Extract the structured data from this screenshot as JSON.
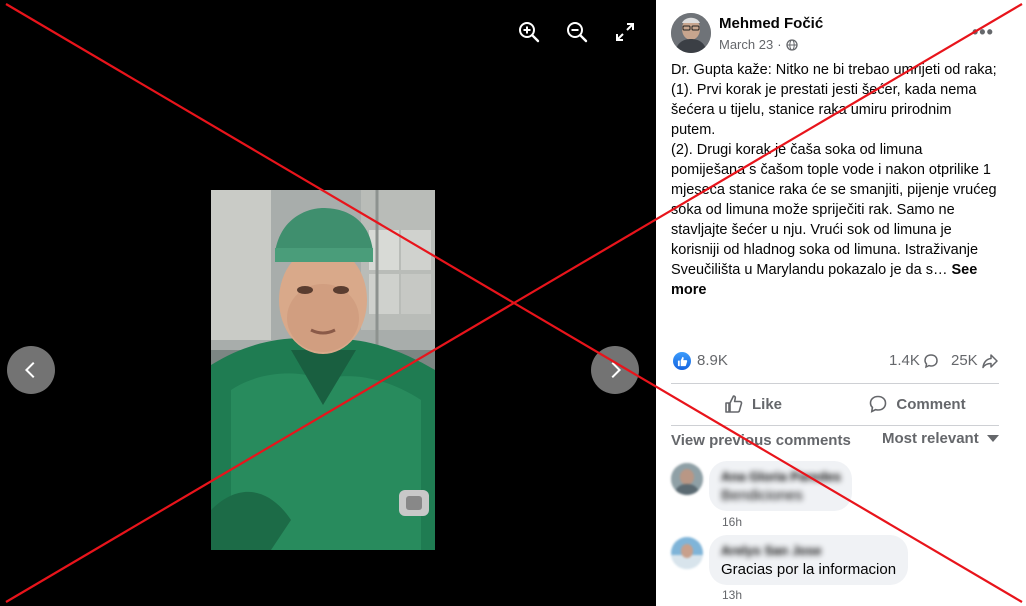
{
  "viewer": {
    "zoom_in_icon": "zoom-in-icon",
    "zoom_out_icon": "zoom-out-icon",
    "fullscreen_icon": "expand-icon",
    "prev_icon": "chevron-left-icon",
    "next_icon": "chevron-right-icon"
  },
  "post": {
    "author": "Mehmed Fočić",
    "date": "March 23",
    "date_separator": "·",
    "audience_icon": "globe-icon",
    "more_icon": "•••",
    "paragraphs": [
      "Dr. Gupta kaže: Nitko ne bi trebao umrijeti od raka;",
      "(1). Prvi korak je prestati jesti šećer, kada nema šećera u tijelu, stanice raka umiru prirodnim putem.",
      "(2). Drugi korak je čaša soka od limuna pomiješana s čašom tople vode i nakon otprilike 1 mjeseca stanice raka će se smanjiti, pijenje vrućeg soka od limuna može spriječiti rak. Samo ne stavljajte šećer u nju. Vrući sok od limuna je korisniji od hladnog soka od limuna. Istraživanje Sveučilišta u Marylandu pokazalo je da s…"
    ],
    "see_more": "See more",
    "reactions": "8.9K",
    "comments_count": "1.4K",
    "shares_count": "25K"
  },
  "actions": {
    "like": "Like",
    "comment": "Comment"
  },
  "comments_section": {
    "view_previous": "View previous comments",
    "sort_label": "Most relevant",
    "items": [
      {
        "name": "Ana Gloria Paredes",
        "text": "Bendiciones",
        "text_blurred": true,
        "time": "16h"
      },
      {
        "name": "Arelys San Jose",
        "text": "Gracias por la informacion",
        "text_blurred": false,
        "time": "13h"
      }
    ]
  },
  "colors": {
    "viewer_bg": "#000000",
    "cross": "#e8141b",
    "secondary_text": "#65676b",
    "bubble_bg": "#f0f2f5",
    "like_blue": "#1877f2"
  }
}
